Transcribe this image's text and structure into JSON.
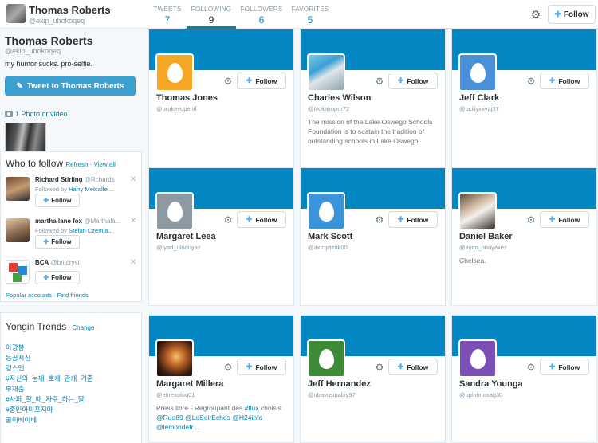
{
  "topbar": {
    "name": "Thomas Roberts",
    "handle": "@ekip_uhokoqeq",
    "stats": [
      {
        "label": "TWEETS",
        "value": "7"
      },
      {
        "label": "FOLLOWING",
        "value": "9"
      },
      {
        "label": "FOLLOWERS",
        "value": "6"
      },
      {
        "label": "FAVORITES",
        "value": "5"
      }
    ],
    "follow_label": "Follow",
    "gear_icon": "gear-icon"
  },
  "profile": {
    "name": "Thomas Roberts",
    "handle": "@ekip_uhokoqeq",
    "bio": "my humor sucks. pro-selfie.",
    "tweet_button": "Tweet to Thomas Roberts",
    "photo_link": "1 Photo or video"
  },
  "who_to_follow": {
    "title": "Who to follow",
    "refresh": "Refresh",
    "sep": " · ",
    "view_all": "View all",
    "items": [
      {
        "name": "Richard Stirling",
        "handle": "@Rchards",
        "followed_by": "Followed by",
        "follower": "Harry Metcalfe ...",
        "follow": "Follow"
      },
      {
        "name": "martha lane fox",
        "handle": "@Marthala...",
        "followed_by": "Followed by",
        "follower": "Stefan Czemia...",
        "follow": "Follow"
      },
      {
        "name": "BCA",
        "handle": "@britcryst",
        "followed_by": "",
        "follower": "",
        "follow": "Follow"
      }
    ],
    "footer": "Popular accounts · Find friends"
  },
  "trends": {
    "title": "Yongin Trends",
    "sep": " · ",
    "change": "Change",
    "items": [
      "아광봉",
      "동공지진",
      "킹스맨",
      "#자신의_눈깨_호캐_관캐_기준",
      "부채춤",
      "#사퍼_할_때_자주_하는_말",
      "#종인아마프지마",
      "콜미베이베"
    ]
  },
  "cards": [
    {
      "name": "Thomas Jones",
      "handle": "@urukevupehif",
      "bio": [],
      "follow": "Follow",
      "avatar_color": "#f5a623"
    },
    {
      "name": "Charles Wilson",
      "handle": "@ivokakopur72",
      "bio": [
        "The mission of the Lake Oswego Schools Foundation is to sustain the tradition of outstanding schools in Lake Oswego."
      ],
      "follow": "Follow",
      "avatar_color": "photo"
    },
    {
      "name": "Jeff Clark",
      "handle": "@ociliyiniyaj37",
      "bio": [],
      "follow": "Follow",
      "avatar_color": "#4a90d9"
    },
    {
      "name": "Margaret Leea",
      "handle": "@iyad_uloduyaz",
      "bio": [],
      "follow": "Follow",
      "avatar_color": "#8e9aa3"
    },
    {
      "name": "Mark Scott",
      "handle": "@axicijifizok00",
      "bio": [],
      "follow": "Follow",
      "avatar_color": "#3b94d9"
    },
    {
      "name": "Daniel Baker",
      "handle": "@ayim_onuyaxez",
      "bio": [
        "Chelsea."
      ],
      "follow": "Follow",
      "avatar_color": "photo"
    },
    {
      "name": "Margaret Millera",
      "handle": "@etirexoloq01",
      "bio": [
        "Press libre - Regroupant des ",
        "#flux",
        " choisis ",
        "@Rue89",
        " ",
        "@LeSoirEchos",
        " ",
        "@H24info",
        " ",
        "@lemondefr",
        " ..."
      ],
      "follow": "Follow",
      "avatar_color": "photo"
    },
    {
      "name": "Jeff Hernandez",
      "handle": "@ubavusipabiy97",
      "bio": [],
      "follow": "Follow",
      "avatar_color": "#3d8b37"
    },
    {
      "name": "Sandra Younga",
      "handle": "@upliomoxag30",
      "bio": [],
      "follow": "Follow",
      "avatar_color": "#7b4fb5"
    }
  ],
  "colors": {
    "header": "#0287c3",
    "link": "#0084b4",
    "tweet_button": "#3ca0d0"
  }
}
